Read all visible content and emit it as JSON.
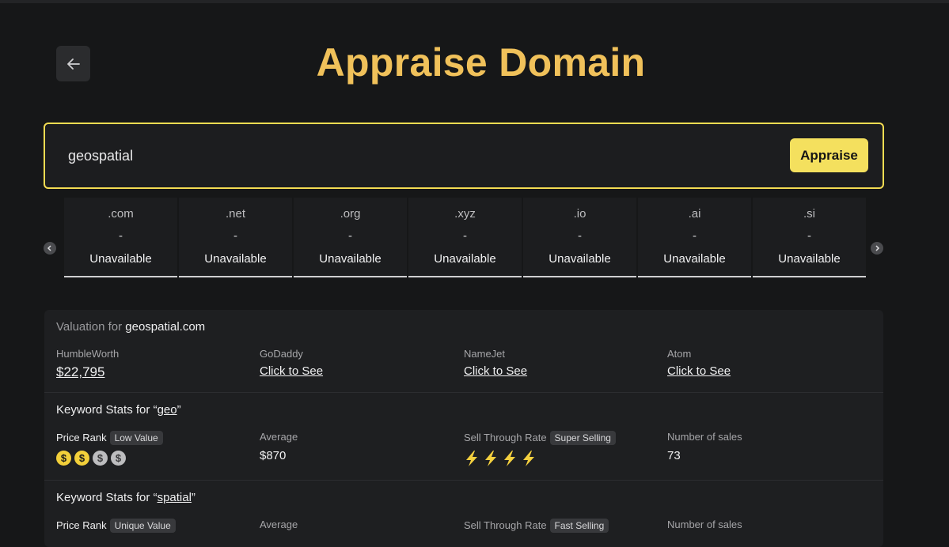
{
  "header": {
    "title": "Appraise Domain"
  },
  "search": {
    "value": "geospatial",
    "button_label": "Appraise"
  },
  "tlds": [
    {
      "ext": ".com",
      "price": "-",
      "status": "Unavailable"
    },
    {
      "ext": ".net",
      "price": "-",
      "status": "Unavailable"
    },
    {
      "ext": ".org",
      "price": "-",
      "status": "Unavailable"
    },
    {
      "ext": ".xyz",
      "price": "-",
      "status": "Unavailable"
    },
    {
      "ext": ".io",
      "price": "-",
      "status": "Unavailable"
    },
    {
      "ext": ".ai",
      "price": "-",
      "status": "Unavailable"
    },
    {
      "ext": ".si",
      "price": "-",
      "status": "Unavailable"
    }
  ],
  "valuation": {
    "prefix": "Valuation for",
    "domain": "geospatial.com",
    "sources": [
      {
        "name": "HumbleWorth",
        "value": "$22,795"
      },
      {
        "name": "GoDaddy",
        "value": "Click to See"
      },
      {
        "name": "NameJet",
        "value": "Click to See"
      },
      {
        "name": "Atom",
        "value": "Click to See"
      }
    ]
  },
  "keyword_stats": [
    {
      "prefix": "Keyword Stats for",
      "open_quote": "“",
      "keyword": "geo",
      "close_quote": "”",
      "price_rank_label": "Price Rank",
      "price_rank_badge": "Low Value",
      "price_rank_level": 2,
      "price_rank_max": 4,
      "average_label": "Average",
      "average_value": "$870",
      "sell_through_label": "Sell Through Rate",
      "sell_through_badge": "Super Selling",
      "sell_through_level": 4,
      "sales_label": "Number of sales",
      "sales_value": "73"
    },
    {
      "prefix": "Keyword Stats for",
      "open_quote": "“",
      "keyword": "spatial",
      "close_quote": "”",
      "price_rank_label": "Price Rank",
      "price_rank_badge": "Unique Value",
      "average_label": "Average",
      "sell_through_label": "Sell Through Rate",
      "sell_through_badge": "Fast Selling",
      "sales_label": "Number of sales"
    }
  ],
  "icons": {
    "back": "arrow-left-icon",
    "prev": "chevron-left-icon",
    "next": "chevron-right-icon",
    "coin": "dollar-coin-icon",
    "bolt": "lightning-icon"
  },
  "colors": {
    "accent": "#f4dc52",
    "title": "#f0c15a",
    "coin_on": "#f2cf3a",
    "bolt": "#f4d03f"
  }
}
